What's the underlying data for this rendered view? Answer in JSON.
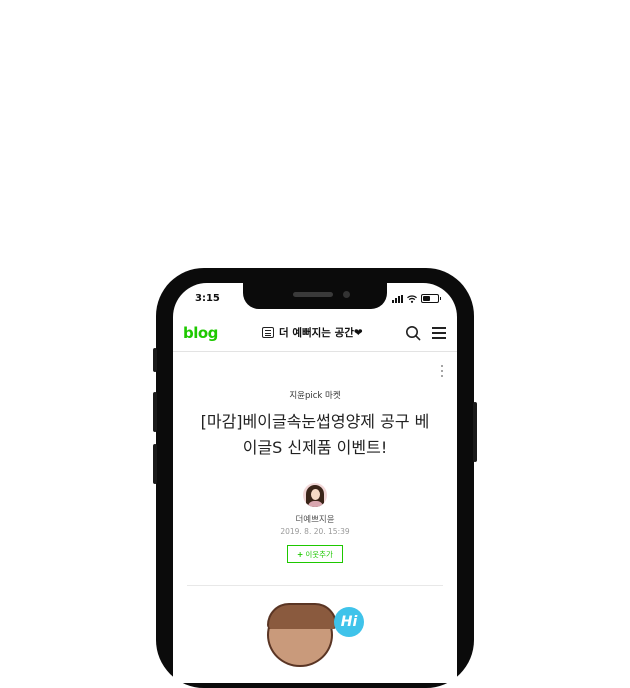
{
  "status_bar": {
    "time": "3:15",
    "battery_level": 0.55
  },
  "header": {
    "logo": "blog",
    "blog_title": "더 예뻐지는 공간❤"
  },
  "post": {
    "category": "지윤pick 마켓",
    "title_line1": "[마감]베이글속눈썹영양제 공구 베",
    "title_line2": "이글S 신제품 이벤트!",
    "author": "더예쁘지윤",
    "date": "2019. 8. 20. 15:39",
    "neighbor_button": "이웃추가",
    "neighbor_icon": "+"
  },
  "illustration": {
    "bubble_text": "Hi"
  },
  "colors": {
    "brand_green": "#1ec800",
    "bubble_blue": "#3fc3ea"
  }
}
